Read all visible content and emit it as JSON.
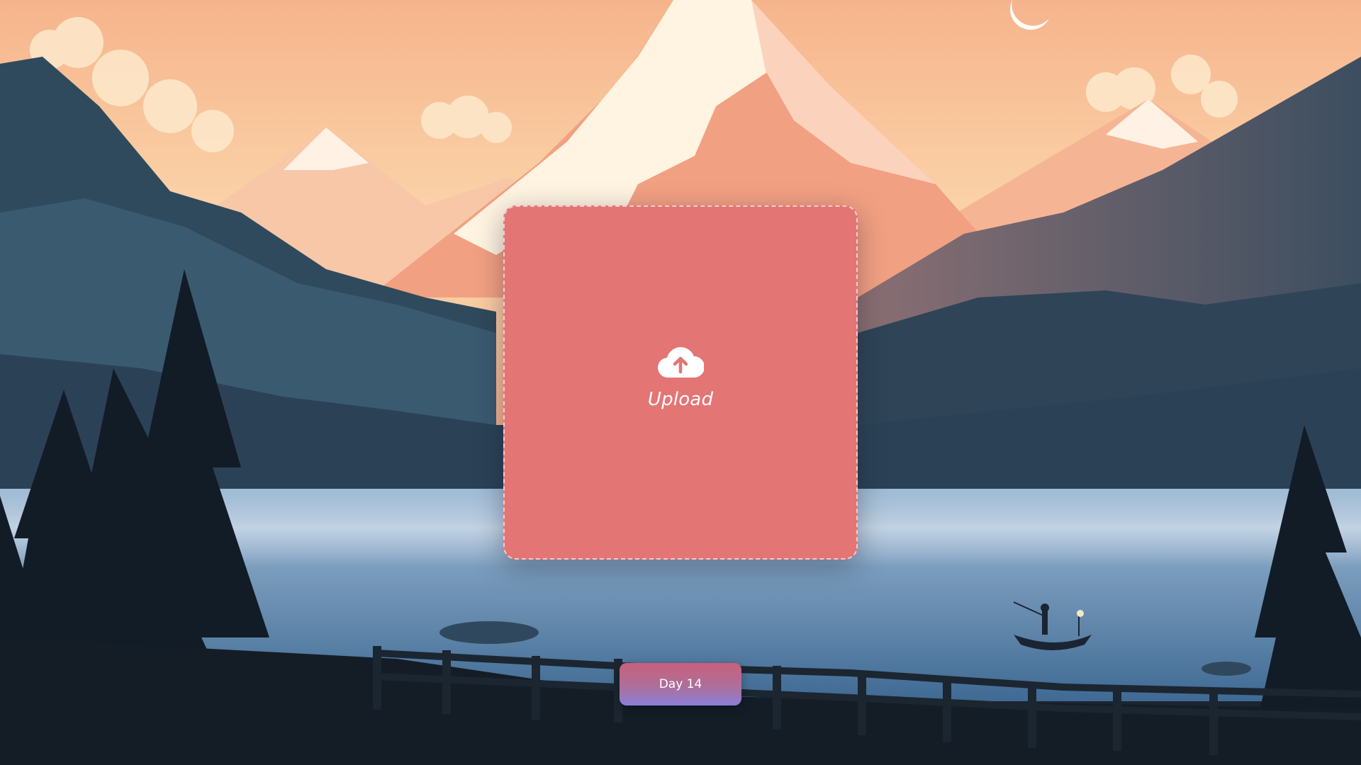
{
  "background": {
    "description_colors": {
      "sky_top": "#f7b98f",
      "sky_bottom": "#fbdcb0",
      "mountain_snow": "#fff3e0",
      "mountain_shadow": "#f4a587",
      "forest_dark": "#1b2a38",
      "lake": "#6a93b8",
      "mist": "#b9cde0"
    }
  },
  "upload": {
    "label": "Upload",
    "icon": "cloud-upload-icon",
    "card_color": "#e37575"
  },
  "day_button": {
    "label": "Day 14"
  }
}
